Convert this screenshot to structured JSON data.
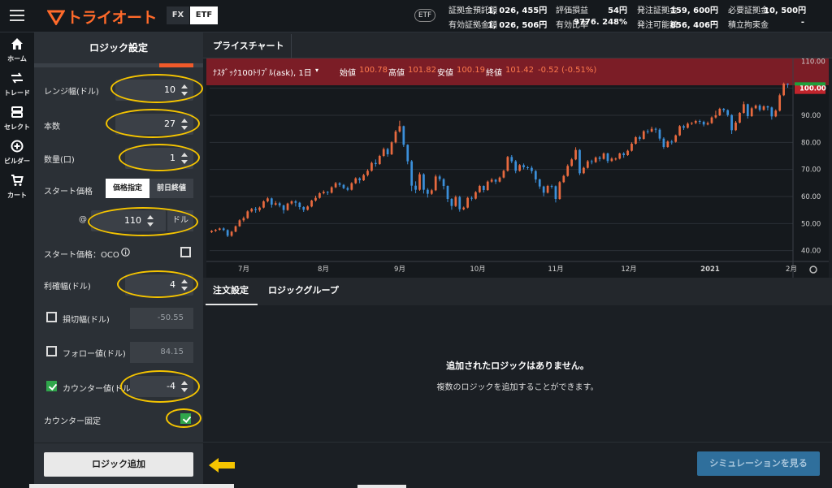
{
  "app": {
    "logo_text": "トライオート"
  },
  "topbar": {
    "segments": {
      "fx": "FX",
      "etf": "ETF"
    },
    "market_badge": "ETF",
    "account": [
      {
        "label": "証拠金預託額",
        "value": "1, 026, 455円"
      },
      {
        "label": "評価損益",
        "value": "54円"
      },
      {
        "label": "発注証拠金",
        "value": "159, 600円"
      },
      {
        "label": "必要証拠金",
        "value": "10, 500円"
      },
      {
        "label": "有効証拠金額",
        "value": "1, 026, 506円"
      },
      {
        "label": "有効比率",
        "value": "9776. 248%"
      },
      {
        "label": "発注可能額",
        "value": "856, 406円"
      },
      {
        "label": "積立拘束金",
        "value": "-"
      }
    ]
  },
  "sidenav": {
    "items": [
      {
        "label": "ホーム",
        "icon": "home-icon"
      },
      {
        "label": "トレード",
        "icon": "trade-icon"
      },
      {
        "label": "セレクト",
        "icon": "select-icon"
      },
      {
        "label": "ビルダー",
        "icon": "builder-icon"
      },
      {
        "label": "カート",
        "icon": "cart-icon"
      }
    ]
  },
  "logic": {
    "title": "ロジック設定",
    "range_width": {
      "label": "レンジ幅(ドル)",
      "value": "10"
    },
    "count": {
      "label": "本数",
      "value": "27"
    },
    "quantity": {
      "label": "数量(口)",
      "value": "1"
    },
    "start_price": {
      "label": "スタート価格",
      "toggle_a": "価格指定",
      "toggle_b": "前日終値",
      "at": "@",
      "value": "110",
      "unit": "ドル"
    },
    "oco": {
      "label": "スタート価格：OCO"
    },
    "take_profit": {
      "label": "利確幅(ドル)",
      "value": "4"
    },
    "stop_loss": {
      "label": "損切幅(ドル)",
      "value": "-50.55"
    },
    "follow": {
      "label": "フォロー値(ドル)",
      "value": "84.15"
    },
    "counter": {
      "label": "カウンター値(ドル)",
      "value": "-4"
    },
    "counter_fixed": {
      "label": "カウンター固定"
    },
    "add_button": "ロジック追加"
  },
  "chart_tab": "プライスチャート",
  "chart_header": {
    "symbol": "ﾅｽﾀﾞｯｸ100ﾄﾘﾌﾟﾙ(ask), 1日",
    "open_label": "始値",
    "open": "100.78",
    "high_label": "高値",
    "high": "101.82",
    "low_label": "安値",
    "low": "100.19",
    "close_label": "終値",
    "close": "101.42",
    "change": "-0.52 (-0.51%)"
  },
  "chart_data": {
    "type": "candlestick",
    "x_ticks": [
      "7月",
      "8月",
      "9月",
      "10月",
      "11月",
      "12月",
      "2021",
      "2月"
    ],
    "y_ticks": [
      "110.00",
      "100.00",
      "90.00",
      "80.00",
      "70.00",
      "60.00",
      "50.00",
      "40.00"
    ],
    "ylim": [
      36,
      111
    ],
    "last_price_label": "100.00",
    "candles": [
      [
        46.8,
        47.3,
        46.5,
        47.6
      ],
      [
        47.3,
        47.7,
        46.9,
        48.0
      ],
      [
        47.7,
        48.2,
        47.4,
        48.5
      ],
      [
        48.2,
        47.6,
        47.2,
        48.6
      ],
      [
        47.6,
        45.5,
        45.0,
        47.9
      ],
      [
        45.5,
        47.0,
        45.1,
        47.3
      ],
      [
        47.0,
        49.0,
        46.8,
        49.3
      ],
      [
        49.0,
        51.2,
        48.8,
        51.6
      ],
      [
        51.2,
        52.0,
        50.6,
        52.6
      ],
      [
        52.0,
        54.5,
        51.7,
        54.9
      ],
      [
        54.5,
        55.4,
        54.1,
        55.8
      ],
      [
        55.4,
        55.0,
        54.0,
        56.1
      ],
      [
        55.0,
        55.9,
        54.4,
        56.3
      ],
      [
        55.9,
        58.2,
        55.6,
        58.6
      ],
      [
        58.2,
        59.3,
        57.8,
        59.8
      ],
      [
        59.3,
        57.0,
        55.9,
        59.6
      ],
      [
        57.0,
        57.5,
        56.6,
        58.3
      ],
      [
        57.5,
        56.7,
        56.0,
        58.0
      ],
      [
        56.7,
        55.0,
        53.7,
        57.0
      ],
      [
        55.0,
        57.4,
        54.7,
        57.7
      ],
      [
        57.4,
        58.2,
        56.9,
        58.6
      ],
      [
        58.2,
        57.7,
        56.3,
        58.7
      ],
      [
        57.7,
        56.1,
        55.2,
        58.0
      ],
      [
        56.1,
        55.1,
        54.3,
        56.4
      ],
      [
        55.1,
        56.3,
        54.8,
        56.7
      ],
      [
        56.3,
        58.5,
        56.0,
        58.8
      ],
      [
        58.5,
        59.5,
        58.1,
        60.3
      ],
      [
        59.5,
        61.2,
        59.2,
        61.6
      ],
      [
        61.2,
        61.7,
        60.8,
        62.3
      ],
      [
        61.7,
        61.4,
        60.6,
        62.0
      ],
      [
        61.4,
        63.4,
        61.1,
        63.8
      ],
      [
        63.4,
        64.9,
        63.1,
        65.4
      ],
      [
        64.9,
        64.3,
        63.6,
        65.3
      ],
      [
        64.3,
        63.1,
        62.7,
        64.6
      ],
      [
        63.1,
        62.5,
        62.0,
        63.7
      ],
      [
        62.5,
        64.9,
        62.2,
        65.3
      ],
      [
        64.9,
        66.7,
        64.6,
        67.1
      ],
      [
        66.7,
        66.0,
        64.9,
        67.1
      ],
      [
        66.0,
        67.9,
        65.7,
        68.4
      ],
      [
        67.9,
        69.5,
        67.4,
        70.1
      ],
      [
        69.5,
        72.4,
        69.2,
        72.9
      ],
      [
        72.4,
        72.0,
        71.0,
        73.7
      ],
      [
        72.0,
        75.0,
        71.7,
        75.4
      ],
      [
        75.0,
        77.5,
        74.6,
        78.1
      ],
      [
        77.5,
        75.6,
        74.7,
        78.0
      ],
      [
        75.6,
        80.0,
        75.3,
        80.4
      ],
      [
        80.0,
        84.0,
        79.6,
        84.6
      ],
      [
        84.0,
        86.0,
        83.6,
        88.0
      ],
      [
        86.0,
        79.1,
        78.3,
        86.2
      ],
      [
        79.1,
        73.0,
        71.9,
        79.3
      ],
      [
        73.0,
        64.0,
        62.0,
        73.5
      ],
      [
        64.0,
        62.5,
        61.2,
        65.6
      ],
      [
        62.5,
        68.2,
        62.1,
        68.9
      ],
      [
        68.2,
        62.5,
        61.1,
        68.6
      ],
      [
        62.5,
        61.0,
        59.6,
        63.1
      ],
      [
        61.0,
        62.3,
        60.6,
        62.8
      ],
      [
        62.3,
        67.4,
        62.0,
        68.1
      ],
      [
        67.4,
        66.4,
        65.6,
        68.0
      ],
      [
        66.4,
        63.9,
        62.6,
        66.8
      ],
      [
        63.9,
        59.1,
        57.9,
        64.1
      ],
      [
        59.1,
        56.5,
        55.1,
        59.4
      ],
      [
        56.5,
        59.8,
        56.1,
        60.4
      ],
      [
        59.8,
        55.3,
        54.4,
        60.3
      ],
      [
        55.3,
        55.9,
        54.9,
        56.3
      ],
      [
        55.9,
        59.5,
        55.6,
        59.9
      ],
      [
        59.5,
        59.2,
        58.4,
        60.1
      ],
      [
        59.2,
        61.6,
        58.9,
        62.0
      ],
      [
        61.6,
        63.9,
        61.3,
        64.3
      ],
      [
        63.9,
        62.4,
        61.5,
        64.1
      ],
      [
        62.4,
        65.5,
        62.1,
        65.9
      ],
      [
        65.5,
        66.2,
        65.1,
        66.8
      ],
      [
        66.2,
        65.5,
        64.6,
        66.5
      ],
      [
        65.5,
        67.0,
        65.2,
        67.4
      ],
      [
        67.0,
        69.5,
        66.7,
        69.9
      ],
      [
        69.5,
        74.6,
        69.2,
        75.0
      ],
      [
        74.6,
        73.0,
        72.3,
        75.3
      ],
      [
        73.0,
        69.5,
        68.6,
        73.5
      ],
      [
        69.5,
        71.6,
        69.2,
        72.0
      ],
      [
        71.6,
        70.8,
        70.0,
        72.2
      ],
      [
        70.8,
        70.6,
        69.9,
        71.3
      ],
      [
        70.6,
        69.4,
        68.5,
        71.3
      ],
      [
        69.4,
        66.3,
        65.1,
        69.8
      ],
      [
        66.3,
        63.7,
        62.8,
        66.6
      ],
      [
        63.7,
        61.4,
        60.1,
        64.0
      ],
      [
        61.4,
        63.9,
        61.1,
        64.3
      ],
      [
        63.9,
        63.8,
        62.9,
        64.4
      ],
      [
        63.8,
        59.1,
        57.8,
        64.1
      ],
      [
        59.1,
        65.3,
        58.8,
        65.7
      ],
      [
        65.3,
        67.6,
        65.0,
        68.0
      ],
      [
        67.6,
        71.3,
        67.3,
        71.9
      ],
      [
        71.3,
        73.7,
        71.0,
        74.2
      ],
      [
        73.7,
        77.2,
        73.4,
        78.2
      ],
      [
        77.2,
        68.6,
        67.9,
        77.5
      ],
      [
        68.6,
        70.6,
        68.3,
        71.0
      ],
      [
        70.6,
        73.0,
        70.3,
        73.5
      ],
      [
        73.0,
        72.7,
        71.9,
        73.6
      ],
      [
        72.7,
        74.4,
        72.4,
        74.8
      ],
      [
        74.4,
        73.9,
        73.0,
        75.0
      ],
      [
        73.9,
        75.9,
        73.6,
        76.3
      ],
      [
        75.9,
        73.1,
        72.3,
        76.2
      ],
      [
        73.1,
        74.0,
        72.8,
        74.5
      ],
      [
        74.0,
        74.0,
        73.3,
        74.4
      ],
      [
        74.0,
        75.9,
        73.7,
        76.2
      ],
      [
        75.9,
        75.3,
        74.3,
        76.4
      ],
      [
        75.3,
        76.9,
        75.0,
        77.3
      ],
      [
        76.9,
        79.5,
        76.6,
        80.0
      ],
      [
        79.5,
        81.9,
        79.2,
        82.3
      ],
      [
        81.9,
        81.3,
        80.5,
        82.5
      ],
      [
        81.3,
        84.1,
        81.0,
        84.5
      ],
      [
        84.1,
        84.0,
        83.2,
        84.8
      ],
      [
        84.0,
        85.0,
        83.7,
        85.8
      ],
      [
        85.0,
        84.7,
        83.5,
        85.5
      ],
      [
        84.7,
        81.4,
        80.6,
        85.2
      ],
      [
        81.4,
        78.3,
        77.6,
        81.9
      ],
      [
        78.3,
        80.3,
        78.0,
        80.7
      ],
      [
        80.3,
        80.2,
        79.2,
        80.9
      ],
      [
        80.2,
        82.6,
        79.9,
        82.9
      ],
      [
        82.6,
        86.0,
        82.3,
        86.4
      ],
      [
        86.0,
        85.4,
        84.6,
        86.5
      ],
      [
        85.4,
        86.9,
        85.1,
        87.4
      ],
      [
        86.9,
        87.2,
        86.4,
        87.5
      ],
      [
        87.2,
        87.9,
        86.7,
        88.3
      ],
      [
        87.9,
        87.6,
        86.7,
        88.4
      ],
      [
        87.6,
        86.6,
        85.9,
        88.0
      ],
      [
        86.6,
        87.1,
        86.3,
        87.7
      ],
      [
        87.1,
        89.2,
        86.8,
        89.6
      ],
      [
        89.2,
        90.0,
        88.8,
        91.7
      ],
      [
        90.0,
        92.4,
        89.7,
        92.8
      ],
      [
        92.4,
        91.9,
        91.1,
        92.7
      ],
      [
        91.9,
        90.1,
        89.5,
        92.2
      ],
      [
        90.1,
        84.5,
        83.1,
        90.4
      ],
      [
        84.5,
        87.3,
        84.2,
        87.9
      ],
      [
        87.3,
        90.9,
        87.0,
        91.2
      ],
      [
        90.9,
        94.1,
        90.6,
        95.1
      ],
      [
        94.1,
        89.7,
        88.8,
        94.3
      ],
      [
        89.7,
        92.6,
        89.4,
        93.1
      ],
      [
        92.6,
        93.6,
        92.3,
        94.0
      ],
      [
        93.6,
        92.0,
        91.4,
        94.1
      ],
      [
        92.0,
        93.3,
        91.7,
        93.7
      ],
      [
        93.3,
        92.9,
        91.8,
        93.6
      ],
      [
        92.9,
        89.6,
        88.4,
        93.2
      ],
      [
        89.6,
        91.7,
        89.3,
        92.2
      ],
      [
        91.7,
        97.4,
        91.4,
        98.0
      ],
      [
        97.4,
        101.7,
        97.1,
        102.1
      ],
      [
        101.7,
        101.4,
        100.2,
        101.8
      ]
    ]
  },
  "order": {
    "tabs": [
      "注文設定",
      "ロジックグループ"
    ],
    "empty_title": "追加されたロジックはありません。",
    "empty_sub": "複数のロジックを追加することができます。",
    "simulate_button": "シミュレーションを見る"
  },
  "colors": {
    "up": "#e86a3f",
    "down": "#3b8fd9",
    "highlight": "#f5c400",
    "accent": "#ff6a2a",
    "header_bg": "#7b1d26"
  }
}
